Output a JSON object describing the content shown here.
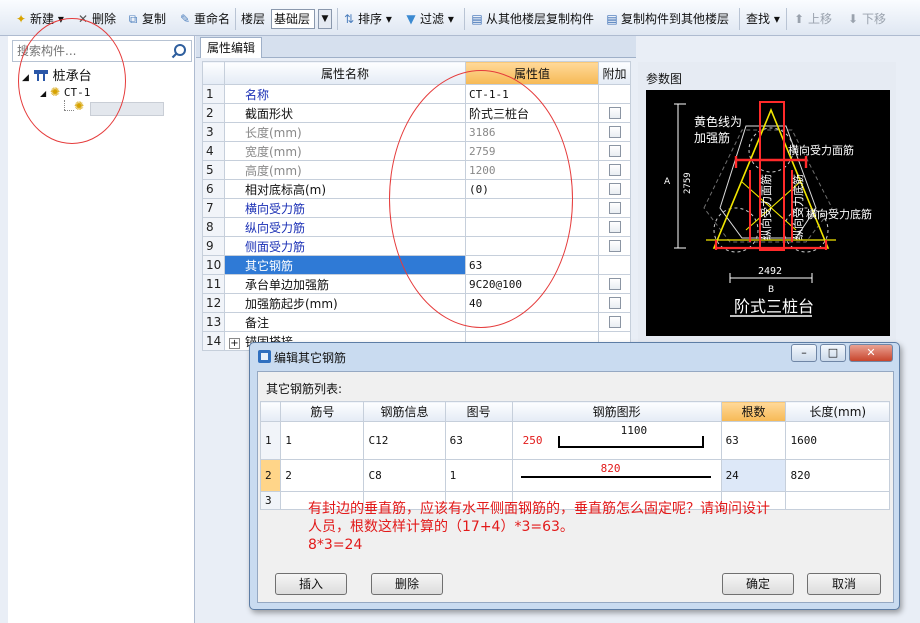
{
  "toolbar": {
    "new": "新建",
    "delete": "删除",
    "copy": "复制",
    "rename": "重命名",
    "floor_label": "楼层",
    "floor_value": "基础层",
    "sort": "排序",
    "filter": "过滤",
    "copy_from_other": "从其他楼层复制构件",
    "copy_to_other": "复制构件到其他楼层",
    "find": "查找",
    "move_up": "上移",
    "move_down": "下移"
  },
  "left": {
    "search_placeholder": "搜索构件...",
    "tree_root": "桩承台",
    "tree_child": "CT-1"
  },
  "grid": {
    "tab": "属性编辑",
    "headers": [
      "属性名称",
      "属性值",
      "附加"
    ],
    "rows": [
      {
        "n": "1",
        "name": "名称",
        "value": "CT-1-1"
      },
      {
        "n": "2",
        "name": "截面形状",
        "value": "阶式三桩台"
      },
      {
        "n": "3",
        "name": "长度(mm)",
        "value": "3186"
      },
      {
        "n": "4",
        "name": "宽度(mm)",
        "value": "2759"
      },
      {
        "n": "5",
        "name": "高度(mm)",
        "value": "1200"
      },
      {
        "n": "6",
        "name": "相对底标高(m)",
        "value": "(0)"
      },
      {
        "n": "7",
        "name": "横向受力筋",
        "value": ""
      },
      {
        "n": "8",
        "name": "纵向受力筋",
        "value": ""
      },
      {
        "n": "9",
        "name": "侧面受力筋",
        "value": ""
      },
      {
        "n": "10",
        "name": "其它钢筋",
        "value": "63"
      },
      {
        "n": "11",
        "name": "承台单边加强筋",
        "value": "9C20@100"
      },
      {
        "n": "12",
        "name": "加强筋起步(mm)",
        "value": "40"
      },
      {
        "n": "13",
        "name": "备注",
        "value": ""
      },
      {
        "n": "14",
        "name": "锚固搭接",
        "value": ""
      }
    ]
  },
  "diagram": {
    "title": "参数图",
    "label_yellow": [
      "黄色线为",
      "加强筋"
    ],
    "label_top_bars": "横向受力面筋",
    "label_left_vertical": "纵向受力面筋",
    "label_mid_vertical": "纵向受力底筋",
    "label_bottom_bars": "横向受力底筋",
    "dim_a": "A",
    "dim_height": "2759",
    "dim_width": "2492",
    "dim_b": "B",
    "caption": "阶式三桩台"
  },
  "dialog": {
    "title": "编辑其它钢筋",
    "list_label": "其它钢筋列表:",
    "headers": [
      "筋号",
      "钢筋信息",
      "图号",
      "钢筋图形",
      "根数",
      "长度(mm)"
    ],
    "rows": [
      {
        "n": "1",
        "bar_no": "1",
        "info": "C12",
        "fig": "63",
        "shape_a": "250",
        "shape_b": "1100",
        "count": "63",
        "length": "1600"
      },
      {
        "n": "2",
        "bar_no": "2",
        "info": "C8",
        "fig": "1",
        "shape_a": "820",
        "count": "24",
        "length": "820"
      },
      {
        "n": "3"
      }
    ],
    "note_line1": "有封边的垂直筋，应该有水平侧面钢筋的，垂直筋怎么固定呢？请询问设计",
    "note_line2": "人员，根数这样计算的（17+4）*3=63。",
    "note_line3": "8*3=24",
    "btn_insert": "插入",
    "btn_delete": "删除",
    "btn_ok": "确定",
    "btn_cancel": "取消"
  },
  "colors": {
    "selection_blue": "#2f7ad6",
    "header_orange": "#f6b955",
    "annotation_red": "#e21a1a",
    "diagram_yellow": "#f2e600",
    "diagram_red": "#ff2a2a"
  }
}
